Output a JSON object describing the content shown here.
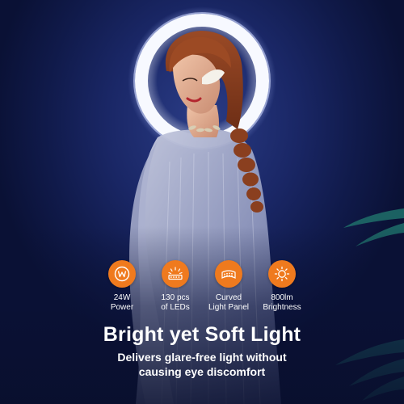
{
  "features": [
    {
      "icon": "wattage-icon",
      "line1": "24W",
      "line2": "Power"
    },
    {
      "icon": "led-strip-icon",
      "line1": "130 pcs",
      "line2": "of LEDs"
    },
    {
      "icon": "curved-panel-icon",
      "line1": "Curved",
      "line2": "Light Panel"
    },
    {
      "icon": "sun-brightness-icon",
      "line1": "800lm",
      "line2": "Brightness"
    }
  ],
  "headline": "Bright yet Soft Light",
  "subheadline": {
    "line1": "Delivers glare-free light without",
    "line2": "causing eye discomfort"
  },
  "colors": {
    "background": "#1a2766",
    "accent": "#ef7a1e",
    "text": "#ffffff"
  }
}
